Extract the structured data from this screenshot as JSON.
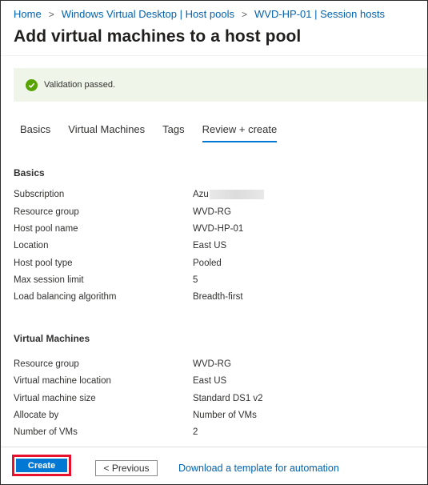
{
  "breadcrumb": {
    "items": [
      "Home",
      "Windows Virtual Desktop | Host pools",
      "WVD-HP-01 | Session hosts"
    ]
  },
  "page": {
    "title": "Add virtual machines to a host pool"
  },
  "validation": {
    "message": "Validation passed.",
    "color": "#57a300"
  },
  "tabs": [
    {
      "label": "Basics",
      "active": false
    },
    {
      "label": "Virtual Machines",
      "active": false
    },
    {
      "label": "Tags",
      "active": false
    },
    {
      "label": "Review + create",
      "active": true
    }
  ],
  "basics": {
    "title": "Basics",
    "rows": [
      {
        "label": "Subscription",
        "value": "Azu"
      },
      {
        "label": "Resource group",
        "value": "WVD-RG"
      },
      {
        "label": "Host pool name",
        "value": "WVD-HP-01"
      },
      {
        "label": "Location",
        "value": "East US"
      },
      {
        "label": "Host pool type",
        "value": "Pooled"
      },
      {
        "label": "Max session limit",
        "value": "5"
      },
      {
        "label": "Load balancing algorithm",
        "value": "Breadth-first"
      }
    ]
  },
  "vms": {
    "title": "Virtual Machines",
    "rows": [
      {
        "label": "Resource group",
        "value": "WVD-RG"
      },
      {
        "label": "Virtual machine location",
        "value": "East US"
      },
      {
        "label": "Virtual machine size",
        "value": "Standard DS1 v2"
      },
      {
        "label": "Allocate by",
        "value": "Number of VMs"
      },
      {
        "label": "Number of VMs",
        "value": "2"
      }
    ]
  },
  "footer": {
    "create_label": "Create",
    "previous_label": "< Previous",
    "download_label": "Download a template for automation"
  },
  "colors": {
    "accent": "#0078d4",
    "highlight": "#e8112d",
    "link": "#0063b1"
  }
}
